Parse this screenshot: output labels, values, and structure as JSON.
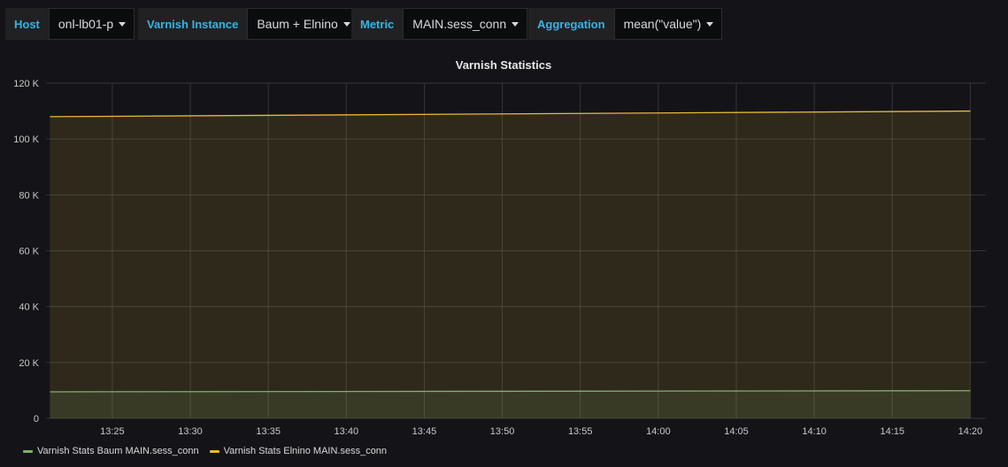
{
  "variables": [
    {
      "label": "Host",
      "value": "onl-lb01-p"
    },
    {
      "label": "Varnish Instance",
      "value": "Baum + Elnino"
    },
    {
      "label": "Metric",
      "value": "MAIN.sess_conn"
    },
    {
      "label": "Aggregation",
      "value": "mean(\"value\")"
    }
  ],
  "panel": {
    "title": "Varnish Statistics"
  },
  "colors": {
    "baum": "#7eb26d",
    "elnino": "#eab839",
    "grid": "#34343a",
    "text": "#c8c8c8"
  },
  "chart_data": {
    "type": "area",
    "title": "Varnish Statistics",
    "x_ticks": [
      "13:25",
      "13:30",
      "13:35",
      "13:40",
      "13:45",
      "13:50",
      "13:55",
      "14:00",
      "14:05",
      "14:10",
      "14:15",
      "14:20"
    ],
    "y_ticks": [
      "0",
      "20 K",
      "40 K",
      "60 K",
      "80 K",
      "100 K",
      "120 K"
    ],
    "ylim": [
      0,
      120000
    ],
    "xlim": [
      "13:20:45",
      "14:21:00"
    ],
    "grid": true,
    "legend_position": "bottom-left",
    "series": [
      {
        "name": "Varnish Stats Baum MAIN.sess_conn",
        "x": [
          "13:21",
          "14:20"
        ],
        "values": [
          9500,
          9900
        ]
      },
      {
        "name": "Varnish Stats Elnino MAIN.sess_conn",
        "x": [
          "13:21",
          "14:20"
        ],
        "values": [
          108000,
          110000
        ]
      }
    ]
  }
}
